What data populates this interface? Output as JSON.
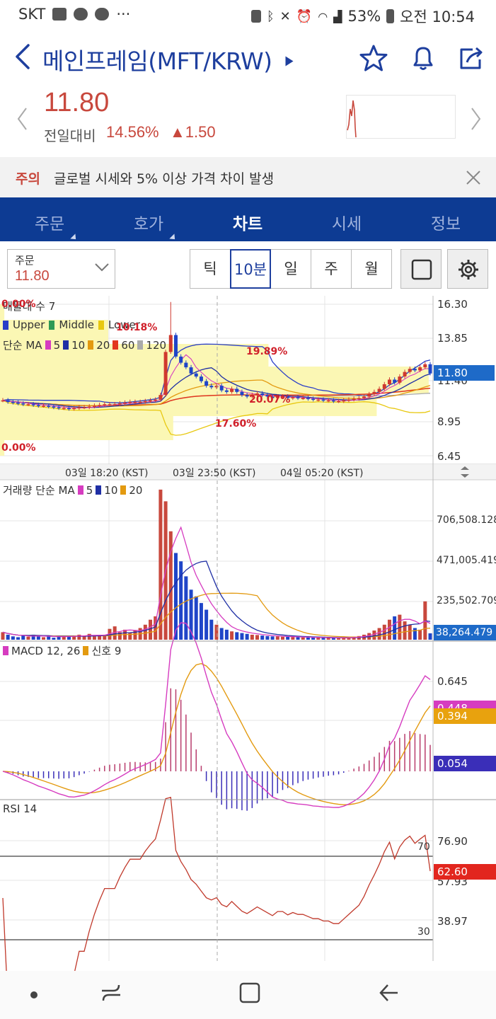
{
  "status_bar": {
    "carrier": "SKT",
    "battery": "53%",
    "time": "오전 10:54"
  },
  "header": {
    "title": "메인프레임(MFT/KRW)"
  },
  "quote": {
    "price": "11.80",
    "change_label": "전일대비",
    "change_pct": "14.56%",
    "change_amt": "▲1.50",
    "up_color": "#c8483d"
  },
  "warning": {
    "tag": "주의",
    "text": "글로벌 시세와 5% 이상 가격 차이 발생"
  },
  "tabs": [
    {
      "label": "주문"
    },
    {
      "label": "호가"
    },
    {
      "label": "차트"
    },
    {
      "label": "시세"
    },
    {
      "label": "정보"
    }
  ],
  "toolbar": {
    "order_label": "주문",
    "order_value": "11.80",
    "periods": [
      "틱",
      "10분",
      "일",
      "주",
      "월"
    ],
    "active_period": "10분"
  },
  "price_panel": {
    "legend_title": "매물대 수 7",
    "bollinger_labels": [
      "Upper",
      "Middle",
      "Lower"
    ],
    "ma_label": "단순 MA",
    "ma_periods": [
      "5",
      "10",
      "20",
      "60",
      "120"
    ],
    "y_ticks": [
      "16.30",
      "13.85",
      "11.40",
      "8.95",
      "6.45"
    ],
    "current_price_tag": "11.80",
    "volume_profile_pcts": [
      "0.00%",
      "10.18%",
      "19.89%",
      "20.07%",
      "17.60%",
      "0.00%"
    ],
    "x_labels": [
      "03일 18:20 (KST)",
      "03일 23:50 (KST)",
      "04일 05:20 (KST)"
    ]
  },
  "volume_panel": {
    "legend_title": "거래량 단순 MA",
    "ma_periods": [
      "5",
      "10",
      "20"
    ],
    "y_ticks": [
      "706,508.128",
      "471,005.419",
      "235,502.709"
    ],
    "current_tag": "38,264.479"
  },
  "macd_panel": {
    "legend_title": "MACD 12, 26",
    "signal_label": "신호 9",
    "y_tick": "0.645",
    "tag_macd": "0.448",
    "tag_signal": "0.394",
    "tag_hist": "0.054"
  },
  "rsi_panel": {
    "legend_title": "RSI 14",
    "y_ticks": [
      "76.90",
      "57.93",
      "38.97"
    ],
    "level_high": "70",
    "level_low": "30",
    "current_tag": "62.60"
  },
  "chart_data": [
    {
      "type": "candlestick",
      "title": "",
      "y_range": [
        6.45,
        16.3
      ],
      "close_series": [
        10.05,
        9.95,
        9.9,
        9.85,
        9.8,
        9.8,
        9.75,
        9.7,
        9.7,
        9.65,
        9.6,
        9.55,
        9.55,
        9.5,
        9.55,
        9.6,
        9.6,
        9.65,
        9.7,
        9.75,
        9.8,
        9.8,
        9.8,
        9.85,
        9.9,
        9.95,
        9.95,
        9.95,
        10.0,
        10.05,
        10.1,
        10.4,
        13.2,
        14.3,
        12.9,
        12.5,
        12.2,
        11.8,
        11.6,
        11.3,
        11.0,
        10.9,
        11.0,
        10.7,
        10.6,
        10.8,
        10.6,
        10.4,
        10.3,
        10.4,
        10.5,
        10.4,
        10.3,
        10.2,
        10.3,
        10.3,
        10.2,
        10.25,
        10.2,
        10.2,
        10.15,
        10.1,
        10.1,
        10.05,
        10.05,
        10.0,
        10.0,
        10.05,
        10.1,
        10.15,
        10.2,
        10.3,
        10.45,
        10.6,
        10.8,
        11.1,
        11.4,
        11.2,
        11.6,
        11.9,
        12.1,
        12.0,
        12.2,
        12.4,
        11.8
      ]
    },
    {
      "type": "bar",
      "title": "",
      "y_range": [
        0,
        942000
      ],
      "values": [
        45000,
        30000,
        20000,
        15000,
        25000,
        18000,
        30000,
        22000,
        15000,
        20000,
        12000,
        25000,
        20000,
        18000,
        22000,
        30000,
        25000,
        35000,
        20000,
        25000,
        30000,
        65000,
        80000,
        45000,
        60000,
        40000,
        55000,
        70000,
        90000,
        120000,
        140000,
        900000,
        830000,
        650000,
        520000,
        470000,
        380000,
        300000,
        260000,
        220000,
        180000,
        120000,
        90000,
        70000,
        60000,
        50000,
        45000,
        40000,
        35000,
        30000,
        28000,
        25000,
        22000,
        20000,
        20000,
        18000,
        18000,
        16000,
        15000,
        14000,
        14000,
        13000,
        12000,
        12000,
        11000,
        11000,
        10000,
        12000,
        14000,
        18000,
        22000,
        30000,
        40000,
        55000,
        70000,
        90000,
        120000,
        140000,
        150000,
        110000,
        90000,
        70000,
        60000,
        230000,
        38264
      ]
    },
    {
      "type": "line",
      "title": "",
      "series": [
        {
          "name": "MACD 12, 26",
          "last": 0.448
        },
        {
          "name": "신호 9",
          "last": 0.394
        }
      ],
      "hist_last": 0.054
    },
    {
      "type": "line",
      "title": "",
      "series": [
        {
          "name": "RSI 14",
          "last": 62.6
        }
      ],
      "levels": [
        70,
        30
      ]
    }
  ]
}
